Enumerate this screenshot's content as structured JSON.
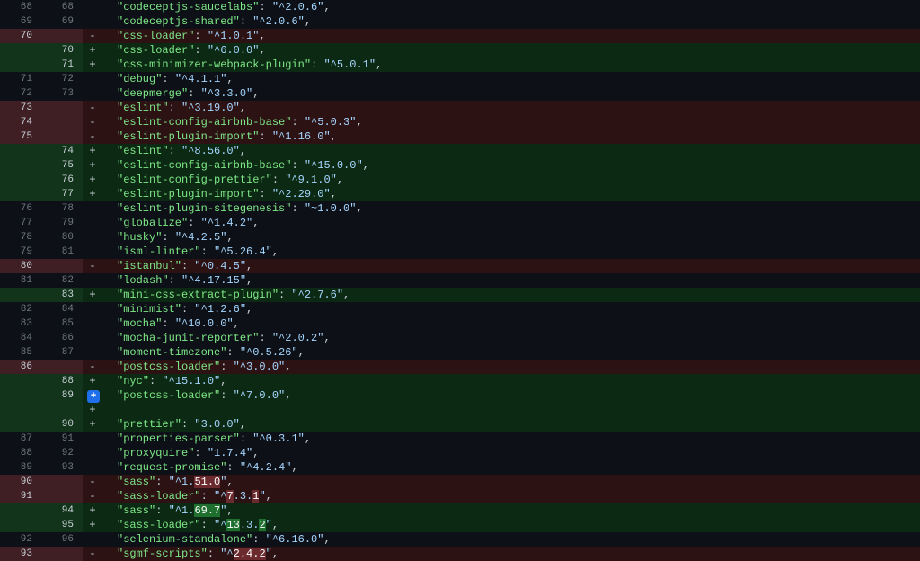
{
  "glyphs": {
    "minus": "-",
    "plus": "+",
    "plus_badge": "+"
  },
  "diff": [
    {
      "type": "ctx",
      "oldNum": "68",
      "newNum": "68",
      "tokens": [
        [
          "key",
          "\"codeceptjs-saucelabs\""
        ],
        [
          "punc",
          ": "
        ],
        [
          "str",
          "\"^2.0.6\""
        ],
        [
          "punc",
          ","
        ]
      ]
    },
    {
      "type": "ctx",
      "oldNum": "69",
      "newNum": "69",
      "tokens": [
        [
          "key",
          "\"codeceptjs-shared\""
        ],
        [
          "punc",
          ": "
        ],
        [
          "str",
          "\"^2.0.6\""
        ],
        [
          "punc",
          ","
        ]
      ]
    },
    {
      "type": "del",
      "oldNum": "70",
      "newNum": "",
      "tokens": [
        [
          "key",
          "\"css-loader\""
        ],
        [
          "punc",
          ": "
        ],
        [
          "str",
          "\"^1.0.1\""
        ],
        [
          "punc",
          ","
        ]
      ]
    },
    {
      "type": "add",
      "oldNum": "",
      "newNum": "70",
      "tokens": [
        [
          "key",
          "\"css-loader\""
        ],
        [
          "punc",
          ": "
        ],
        [
          "str",
          "\"^6.0.0\""
        ],
        [
          "punc",
          ","
        ]
      ]
    },
    {
      "type": "add",
      "oldNum": "",
      "newNum": "71",
      "tokens": [
        [
          "key",
          "\"css-minimizer-webpack-plugin\""
        ],
        [
          "punc",
          ": "
        ],
        [
          "str",
          "\"^5.0.1\""
        ],
        [
          "punc",
          ","
        ]
      ]
    },
    {
      "type": "ctx",
      "oldNum": "71",
      "newNum": "72",
      "tokens": [
        [
          "key",
          "\"debug\""
        ],
        [
          "punc",
          ": "
        ],
        [
          "str",
          "\"^4.1.1\""
        ],
        [
          "punc",
          ","
        ]
      ]
    },
    {
      "type": "ctx",
      "oldNum": "72",
      "newNum": "73",
      "tokens": [
        [
          "key",
          "\"deepmerge\""
        ],
        [
          "punc",
          ": "
        ],
        [
          "str",
          "\"^3.3.0\""
        ],
        [
          "punc",
          ","
        ]
      ]
    },
    {
      "type": "del",
      "oldNum": "73",
      "newNum": "",
      "tokens": [
        [
          "key",
          "\"eslint\""
        ],
        [
          "punc",
          ": "
        ],
        [
          "str",
          "\"^3.19.0\""
        ],
        [
          "punc",
          ","
        ]
      ]
    },
    {
      "type": "del",
      "oldNum": "74",
      "newNum": "",
      "tokens": [
        [
          "key",
          "\"eslint-config-airbnb-base\""
        ],
        [
          "punc",
          ": "
        ],
        [
          "str",
          "\"^5.0.3\""
        ],
        [
          "punc",
          ","
        ]
      ]
    },
    {
      "type": "del",
      "oldNum": "75",
      "newNum": "",
      "tokens": [
        [
          "key",
          "\"eslint-plugin-import\""
        ],
        [
          "punc",
          ": "
        ],
        [
          "str",
          "\"^1.16.0\""
        ],
        [
          "punc",
          ","
        ]
      ]
    },
    {
      "type": "add",
      "oldNum": "",
      "newNum": "74",
      "tokens": [
        [
          "key",
          "\"eslint\""
        ],
        [
          "punc",
          ": "
        ],
        [
          "str",
          "\"^8.56.0\""
        ],
        [
          "punc",
          ","
        ]
      ]
    },
    {
      "type": "add",
      "oldNum": "",
      "newNum": "75",
      "tokens": [
        [
          "key",
          "\"eslint-config-airbnb-base\""
        ],
        [
          "punc",
          ": "
        ],
        [
          "str",
          "\"^15.0.0\""
        ],
        [
          "punc",
          ","
        ]
      ]
    },
    {
      "type": "add",
      "oldNum": "",
      "newNum": "76",
      "tokens": [
        [
          "key",
          "\"eslint-config-prettier\""
        ],
        [
          "punc",
          ": "
        ],
        [
          "str",
          "\"^9.1.0\""
        ],
        [
          "punc",
          ","
        ]
      ]
    },
    {
      "type": "add",
      "oldNum": "",
      "newNum": "77",
      "tokens": [
        [
          "key",
          "\"eslint-plugin-import\""
        ],
        [
          "punc",
          ": "
        ],
        [
          "str",
          "\"^2.29.0\""
        ],
        [
          "punc",
          ","
        ]
      ]
    },
    {
      "type": "ctx",
      "oldNum": "76",
      "newNum": "78",
      "tokens": [
        [
          "key",
          "\"eslint-plugin-sitegenesis\""
        ],
        [
          "punc",
          ": "
        ],
        [
          "str",
          "\"~1.0.0\""
        ],
        [
          "punc",
          ","
        ]
      ]
    },
    {
      "type": "ctx",
      "oldNum": "77",
      "newNum": "79",
      "tokens": [
        [
          "key",
          "\"globalize\""
        ],
        [
          "punc",
          ": "
        ],
        [
          "str",
          "\"^1.4.2\""
        ],
        [
          "punc",
          ","
        ]
      ]
    },
    {
      "type": "ctx",
      "oldNum": "78",
      "newNum": "80",
      "tokens": [
        [
          "key",
          "\"husky\""
        ],
        [
          "punc",
          ": "
        ],
        [
          "str",
          "\"^4.2.5\""
        ],
        [
          "punc",
          ","
        ]
      ]
    },
    {
      "type": "ctx",
      "oldNum": "79",
      "newNum": "81",
      "tokens": [
        [
          "key",
          "\"isml-linter\""
        ],
        [
          "punc",
          ": "
        ],
        [
          "str",
          "\"^5.26.4\""
        ],
        [
          "punc",
          ","
        ]
      ]
    },
    {
      "type": "del",
      "oldNum": "80",
      "newNum": "",
      "tokens": [
        [
          "key",
          "\"istanbul\""
        ],
        [
          "punc",
          ": "
        ],
        [
          "str",
          "\"^0.4.5\""
        ],
        [
          "punc",
          ","
        ]
      ]
    },
    {
      "type": "ctx",
      "oldNum": "81",
      "newNum": "82",
      "tokens": [
        [
          "key",
          "\"lodash\""
        ],
        [
          "punc",
          ": "
        ],
        [
          "str",
          "\"^4.17.15\""
        ],
        [
          "punc",
          ","
        ]
      ]
    },
    {
      "type": "add",
      "oldNum": "",
      "newNum": "83",
      "tokens": [
        [
          "key",
          "\"mini-css-extract-plugin\""
        ],
        [
          "punc",
          ": "
        ],
        [
          "str",
          "\"^2.7.6\""
        ],
        [
          "punc",
          ","
        ]
      ]
    },
    {
      "type": "ctx",
      "oldNum": "82",
      "newNum": "84",
      "tokens": [
        [
          "key",
          "\"minimist\""
        ],
        [
          "punc",
          ": "
        ],
        [
          "str",
          "\"^1.2.6\""
        ],
        [
          "punc",
          ","
        ]
      ]
    },
    {
      "type": "ctx",
      "oldNum": "83",
      "newNum": "85",
      "tokens": [
        [
          "key",
          "\"mocha\""
        ],
        [
          "punc",
          ": "
        ],
        [
          "str",
          "\"^10.0.0\""
        ],
        [
          "punc",
          ","
        ]
      ]
    },
    {
      "type": "ctx",
      "oldNum": "84",
      "newNum": "86",
      "tokens": [
        [
          "key",
          "\"mocha-junit-reporter\""
        ],
        [
          "punc",
          ": "
        ],
        [
          "str",
          "\"^2.0.2\""
        ],
        [
          "punc",
          ","
        ]
      ]
    },
    {
      "type": "ctx",
      "oldNum": "85",
      "newNum": "87",
      "tokens": [
        [
          "key",
          "\"moment-timezone\""
        ],
        [
          "punc",
          ": "
        ],
        [
          "str",
          "\"^0.5.26\""
        ],
        [
          "punc",
          ","
        ]
      ]
    },
    {
      "type": "del",
      "oldNum": "86",
      "newNum": "",
      "tokens": [
        [
          "key",
          "\"postcss-loader\""
        ],
        [
          "punc",
          ": "
        ],
        [
          "str",
          "\"^3.0.0\""
        ],
        [
          "punc",
          ","
        ]
      ]
    },
    {
      "type": "add",
      "oldNum": "",
      "newNum": "88",
      "tokens": [
        [
          "key",
          "\"nyc\""
        ],
        [
          "punc",
          ": "
        ],
        [
          "str",
          "\"^15.1.0\""
        ],
        [
          "punc",
          ","
        ]
      ]
    },
    {
      "type": "add",
      "oldNum": "",
      "newNum": "89",
      "badge": true,
      "tokens": [
        [
          "key",
          "\"postcss-loader\""
        ],
        [
          "punc",
          ": "
        ],
        [
          "str",
          "\"^7.0.0\""
        ],
        [
          "punc",
          ","
        ]
      ]
    },
    {
      "type": "add",
      "oldNum": "",
      "newNum": "90",
      "tokens": [
        [
          "key",
          "\"prettier\""
        ],
        [
          "punc",
          ": "
        ],
        [
          "str",
          "\"3.0.0\""
        ],
        [
          "punc",
          ","
        ]
      ]
    },
    {
      "type": "ctx",
      "oldNum": "87",
      "newNum": "91",
      "tokens": [
        [
          "key",
          "\"properties-parser\""
        ],
        [
          "punc",
          ": "
        ],
        [
          "str",
          "\"^0.3.1\""
        ],
        [
          "punc",
          ","
        ]
      ]
    },
    {
      "type": "ctx",
      "oldNum": "88",
      "newNum": "92",
      "tokens": [
        [
          "key",
          "\"proxyquire\""
        ],
        [
          "punc",
          ": "
        ],
        [
          "str",
          "\"1.7.4\""
        ],
        [
          "punc",
          ","
        ]
      ]
    },
    {
      "type": "ctx",
      "oldNum": "89",
      "newNum": "93",
      "tokens": [
        [
          "key",
          "\"request-promise\""
        ],
        [
          "punc",
          ": "
        ],
        [
          "str",
          "\"^4.2.4\""
        ],
        [
          "punc",
          ","
        ]
      ]
    },
    {
      "type": "del",
      "oldNum": "90",
      "newNum": "",
      "tokens": [
        [
          "key",
          "\"sass\""
        ],
        [
          "punc",
          ": "
        ],
        [
          "str",
          "\"^1."
        ],
        [
          "hldel",
          "51.0"
        ],
        [
          "str",
          "\""
        ],
        [
          "punc",
          ","
        ]
      ]
    },
    {
      "type": "del",
      "oldNum": "91",
      "newNum": "",
      "tokens": [
        [
          "key",
          "\"sass-loader\""
        ],
        [
          "punc",
          ": "
        ],
        [
          "str",
          "\"^"
        ],
        [
          "hldel",
          "7"
        ],
        [
          "str",
          ".3."
        ],
        [
          "hldel",
          "1"
        ],
        [
          "str",
          "\""
        ],
        [
          "punc",
          ","
        ]
      ]
    },
    {
      "type": "add",
      "oldNum": "",
      "newNum": "94",
      "tokens": [
        [
          "key",
          "\"sass\""
        ],
        [
          "punc",
          ": "
        ],
        [
          "str",
          "\"^1."
        ],
        [
          "hladd",
          "69.7"
        ],
        [
          "str",
          "\""
        ],
        [
          "punc",
          ","
        ]
      ]
    },
    {
      "type": "add",
      "oldNum": "",
      "newNum": "95",
      "tokens": [
        [
          "key",
          "\"sass-loader\""
        ],
        [
          "punc",
          ": "
        ],
        [
          "str",
          "\"^"
        ],
        [
          "hladd",
          "13"
        ],
        [
          "str",
          ".3."
        ],
        [
          "hladd",
          "2"
        ],
        [
          "str",
          "\""
        ],
        [
          "punc",
          ","
        ]
      ]
    },
    {
      "type": "ctx",
      "oldNum": "92",
      "newNum": "96",
      "tokens": [
        [
          "key",
          "\"selenium-standalone\""
        ],
        [
          "punc",
          ": "
        ],
        [
          "str",
          "\"^6.16.0\""
        ],
        [
          "punc",
          ","
        ]
      ]
    },
    {
      "type": "del",
      "oldNum": "93",
      "newNum": "",
      "tokens": [
        [
          "key",
          "\"sgmf-scripts\""
        ],
        [
          "punc",
          ": "
        ],
        [
          "str",
          "\"^"
        ],
        [
          "hldel",
          "2.4.2"
        ],
        [
          "str",
          "\""
        ],
        [
          "punc",
          ","
        ]
      ]
    }
  ]
}
